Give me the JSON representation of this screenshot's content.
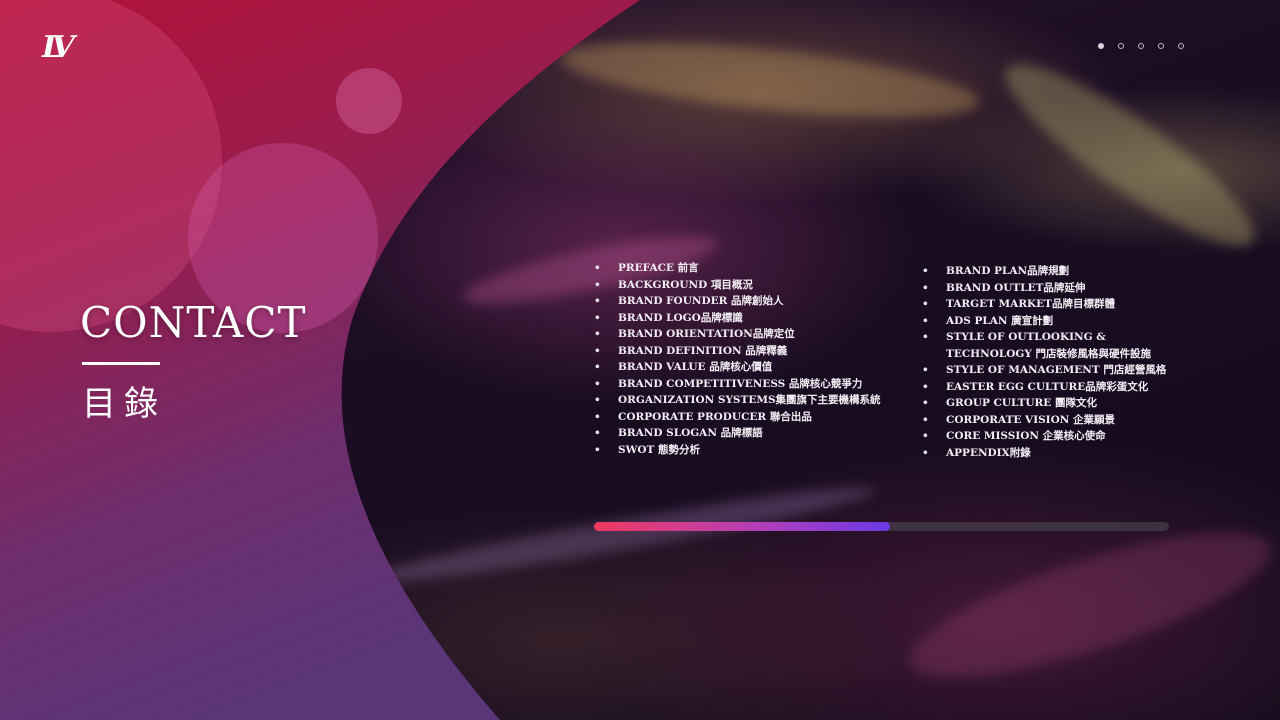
{
  "brand": {
    "logo_text": "LV"
  },
  "pager": {
    "total": 5,
    "active_index": 0
  },
  "heading": {
    "title": "CONTACT",
    "subtitle": "目錄"
  },
  "toc": {
    "left": [
      "PREFACE 前言",
      "BACKGROUND 項目概況",
      "BRAND FOUNDER 品牌創始人",
      "BRAND LOGO品牌標識",
      "BRAND ORIENTATION品牌定位",
      "BRAND DEFINITION 品牌釋義",
      "BRAND VALUE 品牌核心價值",
      "BRAND COMPETITIVENESS 品牌核心競爭力",
      "ORGANIZATION SYSTEMS集團旗下主要機構系統",
      "CORPORATE PRODUCER 聯合出品",
      "BRAND SLOGAN 品牌標語",
      "SWOT 態勢分析"
    ],
    "right": [
      "BRAND PLAN品牌規劃",
      "BRAND OUTLET品牌延伸",
      "TARGET MARKET品牌目標群體",
      "ADS PLAN 廣宣計劃",
      "STYLE OF OUTLOOKING & TECHNOLOGY 門店裝修風格與硬件設施",
      "STYLE OF MANAGEMENT 門店經營風格",
      "EASTER EGG CULTURE品牌彩蛋文化",
      "GROUP CULTURE 團隊文化",
      "CORPORATE VISION 企業願景",
      "CORE MISSION 企業核心使命",
      "APPENDIX附錄"
    ]
  },
  "progress": {
    "value": 0.515
  },
  "colors": {
    "accent_red": "#f03a5f",
    "accent_violet": "#6a39e6",
    "wave_top": "#b0123a",
    "wave_bottom": "#5a3578"
  }
}
